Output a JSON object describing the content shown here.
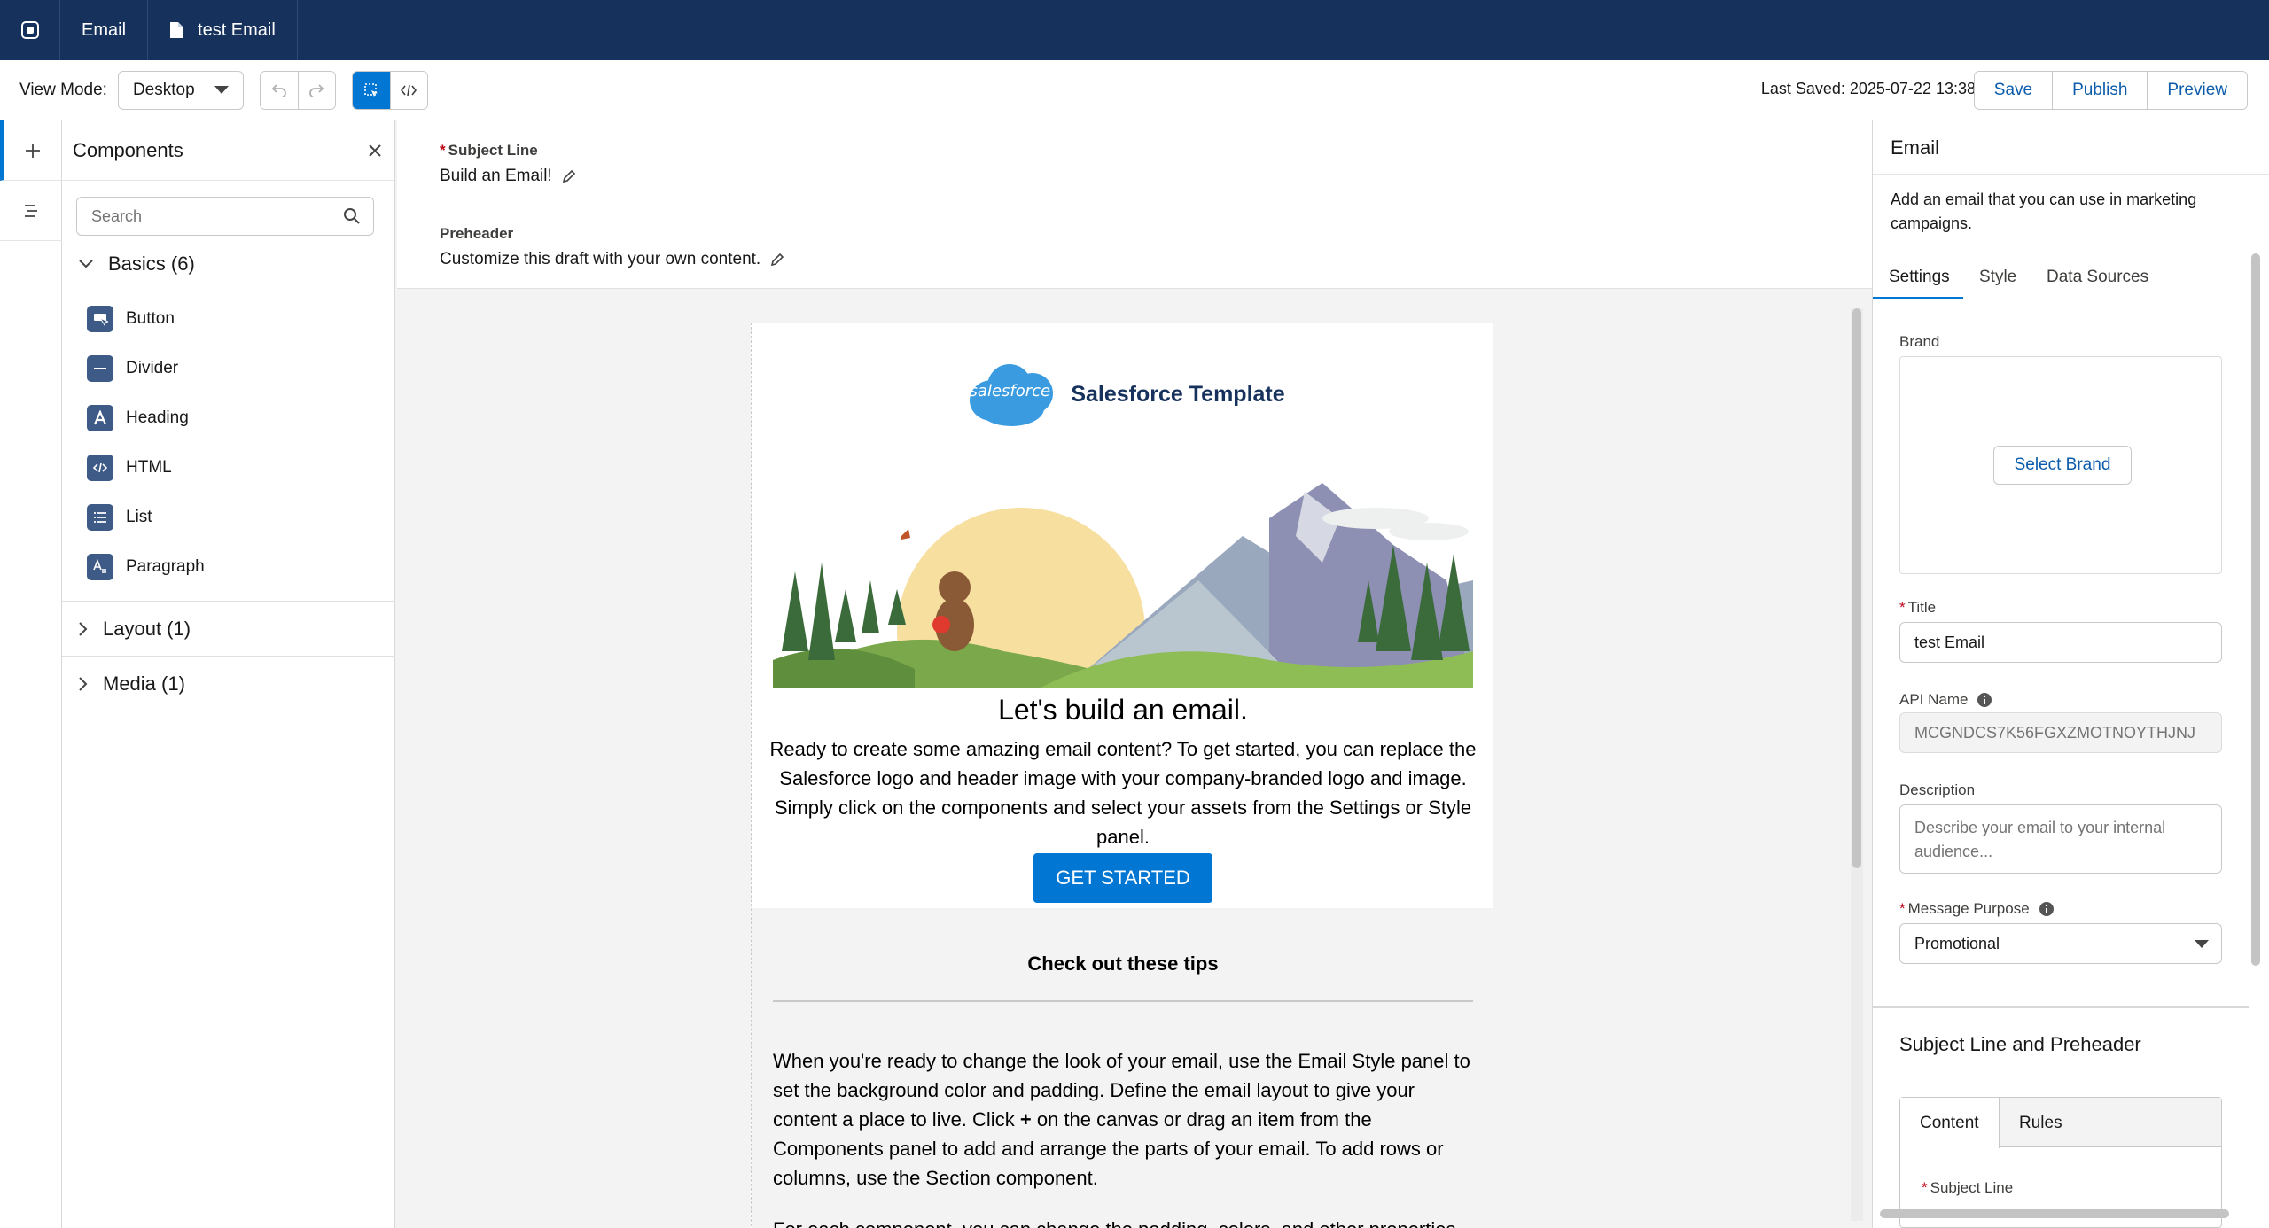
{
  "topbar": {
    "app_icon": "email-builder-icon",
    "tabs": [
      {
        "label": "Email"
      },
      {
        "label": "test Email",
        "icon": "document-icon"
      }
    ]
  },
  "toolbar": {
    "view_mode_label": "View Mode:",
    "view_mode_value": "Desktop",
    "last_saved": "Last Saved: 2025-07-22 13:38",
    "save_label": "Save",
    "publish_label": "Publish",
    "preview_label": "Preview"
  },
  "components_panel": {
    "title": "Components",
    "search_placeholder": "Search",
    "sections": [
      {
        "label": "Basics (6)",
        "expanded": true
      },
      {
        "label": "Layout (1)",
        "expanded": false
      },
      {
        "label": "Media (1)",
        "expanded": false
      }
    ],
    "basics": [
      {
        "label": "Button",
        "icon": "button-icon"
      },
      {
        "label": "Divider",
        "icon": "divider-icon"
      },
      {
        "label": "Heading",
        "icon": "heading-icon"
      },
      {
        "label": "HTML",
        "icon": "html-icon"
      },
      {
        "label": "List",
        "icon": "list-icon"
      },
      {
        "label": "Paragraph",
        "icon": "paragraph-icon"
      }
    ]
  },
  "header_fields": {
    "subject_label": "Subject Line",
    "subject_value": "Build an Email!",
    "preheader_label": "Preheader",
    "preheader_value": "Customize this draft with your own content."
  },
  "email": {
    "logo_text": "salesforce",
    "logo_title": "Salesforce Template",
    "heading": "Let's build an email.",
    "body": "Ready to create some amazing email content? To get started, you can replace the Salesforce logo and header image with your company-branded logo and image. Simply click on the components and select your assets from the Settings or Style panel.",
    "cta": "GET STARTED",
    "tips_title": "Check out these tips",
    "tips_text_1": "When you're ready to change the look of your email, use the Email Style panel to set the background color and padding. Define the email layout to give your content a place to live. Click",
    "tips_plus": "+",
    "tips_text_2": "on the canvas or drag an item from the Components panel to add and arrange the parts of your email. To add rows or columns, use the Section component.",
    "tips_text_3": "For each component, you can change the padding, colors, and other properties"
  },
  "right_panel": {
    "title": "Email",
    "description": "Add an email that you can use in marketing campaigns.",
    "tabs": [
      "Settings",
      "Style",
      "Data Sources"
    ],
    "brand_label": "Brand",
    "select_brand": "Select Brand",
    "title_label": "Title",
    "title_value": "test Email",
    "api_name_label": "API Name",
    "api_name_value": "MCGNDCS7K56FGXZMOTNOYTHJNJ",
    "description_label": "Description",
    "description_placeholder": "Describe your email to your internal audience...",
    "purpose_label": "Message Purpose",
    "purpose_value": "Promotional",
    "subsection_title": "Subject Line and Preheader",
    "subtabs": [
      "Content",
      "Rules"
    ],
    "sub_subject_label": "Subject Line"
  },
  "colors": {
    "topbar": "#16325c",
    "brand_blue": "#0176d3",
    "link_blue": "#0b5cab",
    "required_red": "#ba0517"
  }
}
